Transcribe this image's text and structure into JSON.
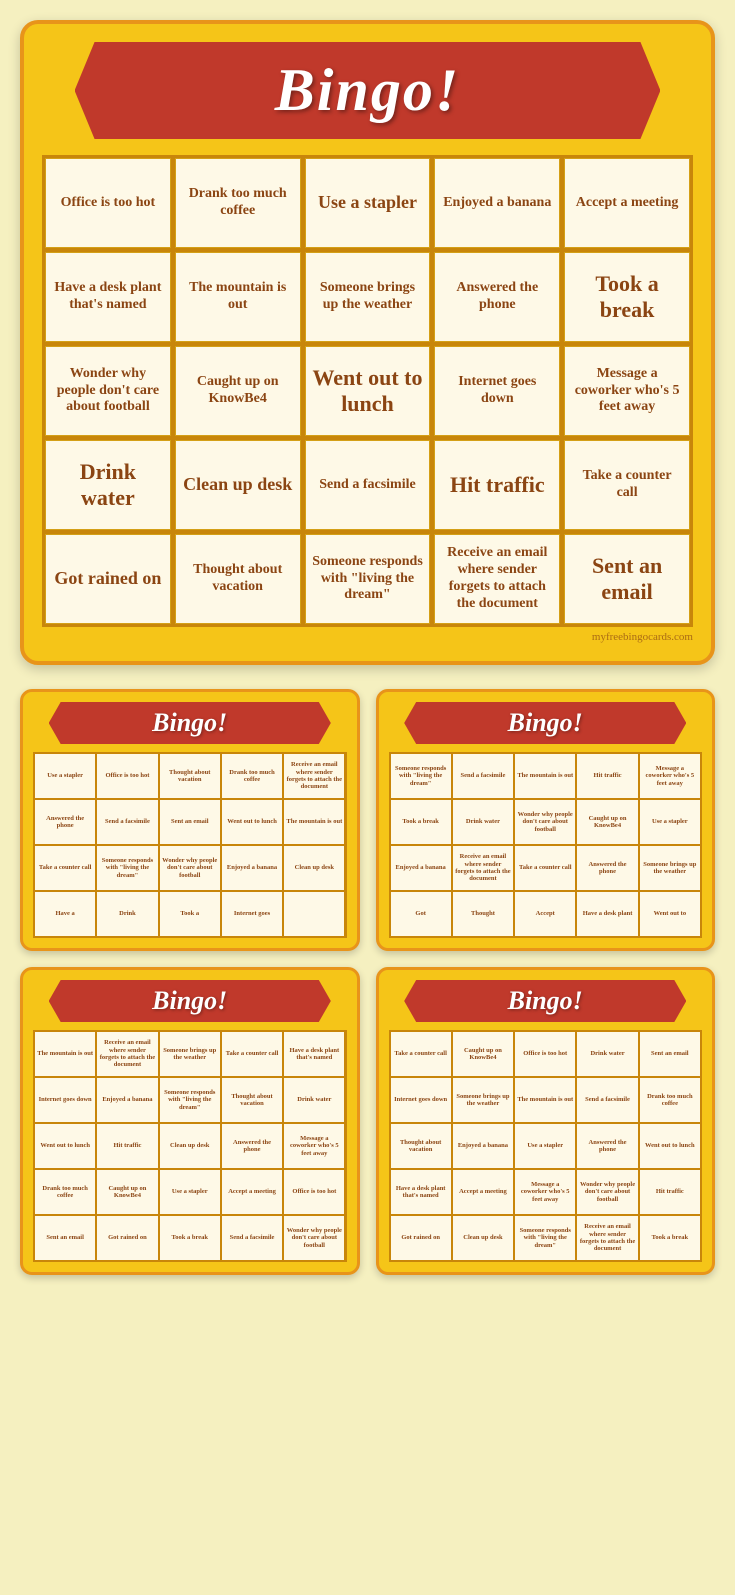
{
  "main_card": {
    "title": "Bingo!",
    "watermark": "myfreebingocards.com",
    "cells": [
      {
        "text": "Office is too hot",
        "size": "normal"
      },
      {
        "text": "Drank too much coffee",
        "size": "normal"
      },
      {
        "text": "Use a stapler",
        "size": "bold-large"
      },
      {
        "text": "Enjoyed a banana",
        "size": "normal"
      },
      {
        "text": "Accept a meeting",
        "size": "normal"
      },
      {
        "text": "Have a desk plant that's named",
        "size": "normal"
      },
      {
        "text": "The mountain is out",
        "size": "normal"
      },
      {
        "text": "Someone brings up the weather",
        "size": "normal"
      },
      {
        "text": "Answered the phone",
        "size": "normal"
      },
      {
        "text": "Took a break",
        "size": "extra-large"
      },
      {
        "text": "Wonder why people don't care about football",
        "size": "normal"
      },
      {
        "text": "Caught up on KnowBe4",
        "size": "normal"
      },
      {
        "text": "Went out to lunch",
        "size": "extra-large"
      },
      {
        "text": "Internet goes down",
        "size": "normal"
      },
      {
        "text": "Message a coworker who's 5 feet away",
        "size": "normal"
      },
      {
        "text": "Drink water",
        "size": "extra-large"
      },
      {
        "text": "Clean up desk",
        "size": "bold-large"
      },
      {
        "text": "Send a facsimile",
        "size": "normal"
      },
      {
        "text": "Hit traffic",
        "size": "extra-large"
      },
      {
        "text": "Take a counter call",
        "size": "normal"
      },
      {
        "text": "Got rained on",
        "size": "bold-large"
      },
      {
        "text": "Thought about vacation",
        "size": "normal"
      },
      {
        "text": "Someone responds with \"living the dream\"",
        "size": "normal"
      },
      {
        "text": "Receive an email where sender forgets to attach the document",
        "size": "normal"
      },
      {
        "text": "Sent an email",
        "size": "extra-large"
      }
    ]
  },
  "small_cards": [
    {
      "title": "Bingo!",
      "cells": [
        {
          "text": "Use a stapler"
        },
        {
          "text": "Office is too hot"
        },
        {
          "text": "Thought about vacation"
        },
        {
          "text": "Drank too much coffee"
        },
        {
          "text": "Receive an email where sender forgets to attach the document"
        },
        {
          "text": "Answered the phone"
        },
        {
          "text": "Send a facsimile"
        },
        {
          "text": "Sent an email"
        },
        {
          "text": "Went out to lunch"
        },
        {
          "text": "The mountain is out"
        },
        {
          "text": "Take a counter call"
        },
        {
          "text": "Someone responds with \"living the dream\""
        },
        {
          "text": "Wonder why people don't care about football"
        },
        {
          "text": "Enjoyed a banana"
        },
        {
          "text": "Clean up desk"
        },
        {
          "text": "Have a"
        },
        {
          "text": "Drink"
        },
        {
          "text": "Took a"
        },
        {
          "text": "Internet goes"
        },
        {
          "text": ""
        }
      ]
    },
    {
      "title": "Bingo!",
      "cells": [
        {
          "text": "Someone responds with \"living the dream\""
        },
        {
          "text": "Send a facsimile"
        },
        {
          "text": "The mountain is out"
        },
        {
          "text": "Hit traffic"
        },
        {
          "text": "Message a coworker who's 5 feet away"
        },
        {
          "text": "Took a break"
        },
        {
          "text": "Drink water"
        },
        {
          "text": "Wonder why people don't care about football"
        },
        {
          "text": "Caught up on KnowBe4"
        },
        {
          "text": "Use a stapler"
        },
        {
          "text": "Enjoyed a banana"
        },
        {
          "text": "Receive an email where sender forgets to attach the document"
        },
        {
          "text": "Take a counter call"
        },
        {
          "text": "Answered the phone"
        },
        {
          "text": "Someone brings up the weather"
        },
        {
          "text": "Got"
        },
        {
          "text": "Thought"
        },
        {
          "text": "Accept"
        },
        {
          "text": "Have a desk plant"
        },
        {
          "text": "Went out to"
        }
      ]
    },
    {
      "title": "Bingo!",
      "cells": [
        {
          "text": "The mountain is out"
        },
        {
          "text": "Receive an email where sender forgets to attach the document"
        },
        {
          "text": "Someone brings up the weather"
        },
        {
          "text": "Take a counter call"
        },
        {
          "text": "Have a desk plant that's named"
        },
        {
          "text": "Internet goes down"
        },
        {
          "text": "Enjoyed a banana"
        },
        {
          "text": "Someone responds with \"living the dream\""
        },
        {
          "text": "Thought about vacation"
        },
        {
          "text": "Drink water"
        },
        {
          "text": "Went out to lunch"
        },
        {
          "text": "Hit traffic"
        },
        {
          "text": "Clean up desk"
        },
        {
          "text": "Answered the phone"
        },
        {
          "text": "Message a coworker who's 5 feet away"
        },
        {
          "text": "Drank too much coffee"
        },
        {
          "text": "Caught up on KnowBe4"
        },
        {
          "text": "Use a stapler"
        },
        {
          "text": "Accept a meeting"
        },
        {
          "text": "Office is too hot"
        },
        {
          "text": "Sent an email"
        },
        {
          "text": "Got rained on"
        },
        {
          "text": "Took a break"
        },
        {
          "text": "Send a facsimile"
        },
        {
          "text": "Wonder why people don't care about football"
        }
      ]
    },
    {
      "title": "Bingo!",
      "cells": [
        {
          "text": "Take a counter call"
        },
        {
          "text": "Caught up on KnowBe4"
        },
        {
          "text": "Office is too hot"
        },
        {
          "text": "Drink water"
        },
        {
          "text": "Sent an email"
        },
        {
          "text": "Internet goes down"
        },
        {
          "text": "Someone brings up the weather"
        },
        {
          "text": "The mountain is out"
        },
        {
          "text": "Send a facsimile"
        },
        {
          "text": "Drank too much coffee"
        },
        {
          "text": "Thought about vacation"
        },
        {
          "text": "Enjoyed a banana"
        },
        {
          "text": "Use a stapler"
        },
        {
          "text": "Answered the phone"
        },
        {
          "text": "Went out to lunch"
        },
        {
          "text": "Have a desk plant that's named"
        },
        {
          "text": "Accept a meeting"
        },
        {
          "text": "Message a coworker who's 5 feet away"
        },
        {
          "text": "Wonder why people don't care about football"
        },
        {
          "text": "Hit traffic"
        },
        {
          "text": "Got rained on"
        },
        {
          "text": "Clean up desk"
        },
        {
          "text": "Someone responds with \"living the dream\""
        },
        {
          "text": "Receive an email where sender forgets to attach the document"
        },
        {
          "text": "Took a break"
        }
      ]
    }
  ]
}
